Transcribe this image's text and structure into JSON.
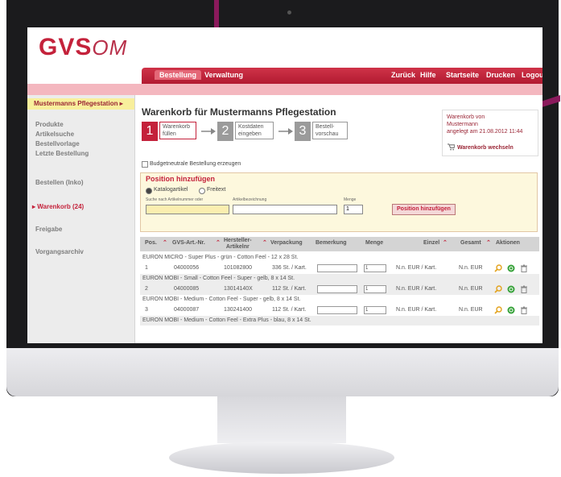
{
  "colors": {
    "accent": "#c4223b",
    "accent_dark": "#9a2535",
    "nav_red": "#cf3348",
    "pink": "#f4b7bf",
    "yellow_panel": "#fdf8dd",
    "sidebar_highlight": "#f8ef9c",
    "arrow_purple": "#8b1a5c",
    "icon_green": "#37a23a",
    "icon_orange": "#e3a21b"
  },
  "logo": {
    "brand": "GVS",
    "suffix": "OM"
  },
  "nav": {
    "left_tabs": [
      "Bestellung",
      "Verwaltung"
    ],
    "right_tabs": [
      "Zurück",
      "Hilfe",
      "Startseite",
      "Drucken",
      "Logout"
    ]
  },
  "sidebar": {
    "header": "Mustermanns Pflegestation ▸",
    "group1": [
      "Produkte",
      "Artikelsuche",
      "Bestellvorlage",
      "Letzte Bestellung"
    ],
    "bestellen": "Bestellen (Inko)",
    "warenkorb": "Warenkorb (24)",
    "freigabe": "Freigabe",
    "vorgang": "Vorgangsarchiv"
  },
  "page": {
    "title": "Warenkorb für Mustermanns Pflegestation",
    "steps": [
      {
        "num": "1",
        "label1": "Warenkorb",
        "label2": "füllen"
      },
      {
        "num": "2",
        "label1": "Kostdaten",
        "label2": "eingeben"
      },
      {
        "num": "3",
        "label1": "Bestell-",
        "label2": "vorschau"
      }
    ],
    "cart": {
      "line1": "Warenkorb von",
      "line2": "Mustermann",
      "line3": "angelegt am 21.08.2012 11:44",
      "link": "Warenkorb wechseln"
    },
    "budget_label": "Budgetneutrale Bestellung erzeugen"
  },
  "position": {
    "title": "Position hinzufügen",
    "radio1": "Katalogartikel",
    "radio2": "Freitext",
    "search_label": "Suche nach Artikelnummer oder",
    "desc_label": "Artikelbezeichnung",
    "qty_label": "Menge",
    "qty_value": "1",
    "button": "Position hinzufügen"
  },
  "table": {
    "headers": {
      "pos": "Pos.",
      "gvs": "GVS-Art.-Nr.",
      "herst1": "Hersteller-",
      "herst2": "Artikelnr",
      "verpackung": "Verpackung",
      "bemerkung": "Bemerkung",
      "menge": "Menge",
      "einzel": "Einzel",
      "gesamt": "Gesamt",
      "aktionen": "Aktionen"
    },
    "rows": [
      {
        "desc": "EURON MICRO - Super Plus - grün - Cotton Feel - 12 x 28 St.",
        "pos": "1",
        "gvs": "04000056",
        "herst": "101082800",
        "verp": "336 St. / Kart.",
        "menge": "1",
        "einzel": "N.n. EUR / Kart.",
        "gesamt": "N.n. EUR"
      },
      {
        "desc": "EURON MOBI - Small - Cotton Feel - Super - gelb, 8 x 14 St.",
        "pos": "2",
        "gvs": "04000085",
        "herst": "13014140X",
        "verp": "112 St. / Kart.",
        "menge": "1",
        "einzel": "N.n. EUR / Kart.",
        "gesamt": "N.n. EUR"
      },
      {
        "desc": "EURON MOBI - Medium - Cotton Feel - Super - gelb, 8 x 14 St.",
        "pos": "3",
        "gvs": "04000087",
        "herst": "130241400",
        "verp": "112 St. / Kart.",
        "menge": "1",
        "einzel": "N.n. EUR / Kart.",
        "gesamt": "N.n. EUR"
      },
      {
        "desc": "EURON MOBI - Medium - Cotton Feel - Extra Plus - blau, 8 x 14 St."
      }
    ]
  }
}
